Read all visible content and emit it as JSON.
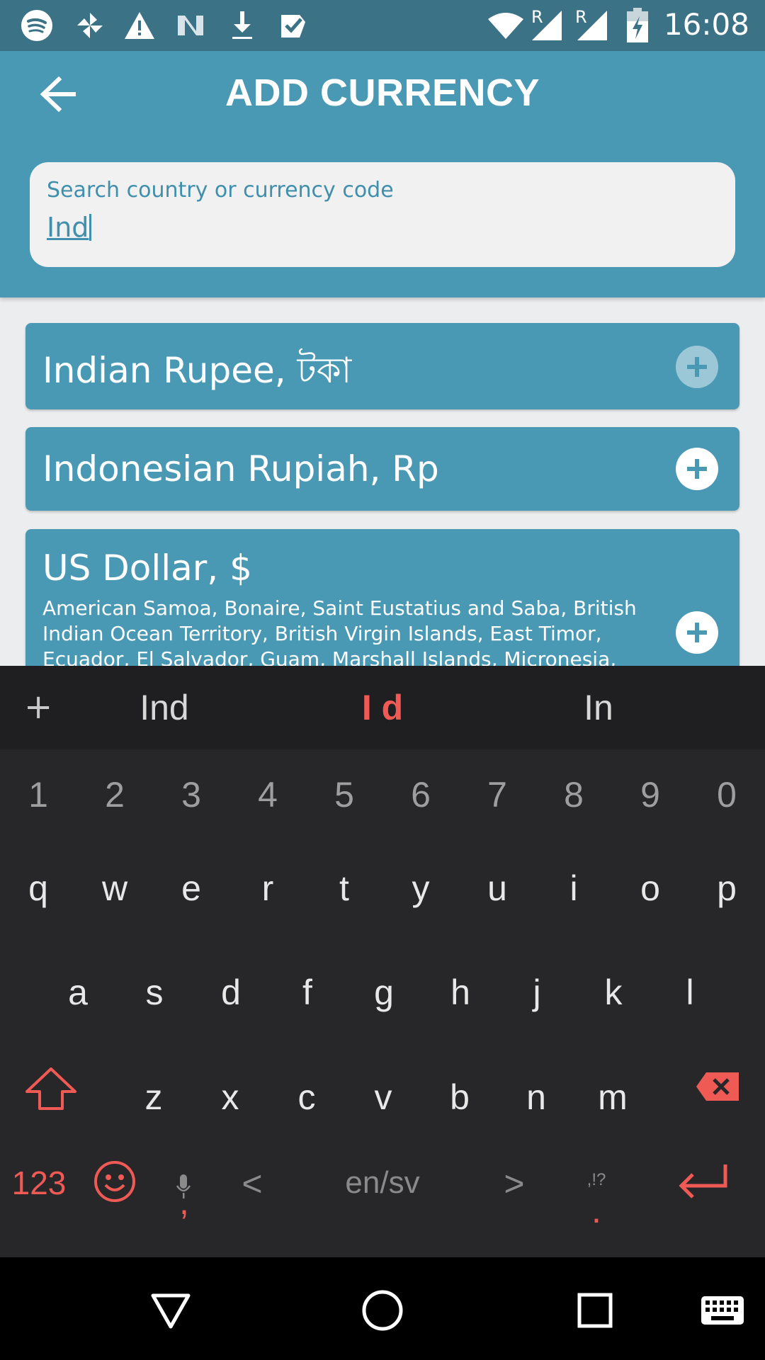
{
  "status_bar": {
    "time": "16:08",
    "left_icons": [
      "spotify-icon",
      "pinwheel-icon",
      "warning-icon",
      "n-icon",
      "download-icon",
      "check-icon"
    ],
    "right_icons": [
      "wifi-icon",
      "signal-icon",
      "signal-icon",
      "battery-charging-icon"
    ],
    "roaming_label": "R"
  },
  "app_bar": {
    "title": "ADD CURRENCY",
    "back_icon": "arrow-left-icon"
  },
  "search": {
    "label": "Search country or currency code",
    "value": "Ind"
  },
  "currencies": [
    {
      "name": "Indian Rupee, টকা",
      "countries": "",
      "added": true
    },
    {
      "name": "Indonesian Rupiah, Rp",
      "countries": "",
      "added": false
    },
    {
      "name": "US Dollar, $",
      "countries": "American Samoa, Bonaire, Saint Eustatius and Saba, British Indian Ocean Territory, British Virgin Islands, East Timor, Ecuador, El Salvador, Guam, Marshall Islands, Micronesia, Northern Mariana",
      "added": false
    }
  ],
  "keyboard": {
    "suggestions": {
      "plus": "+",
      "left": "Ind",
      "center": "I d",
      "right": "In"
    },
    "row_numbers": [
      "1",
      "2",
      "3",
      "4",
      "5",
      "6",
      "7",
      "8",
      "9",
      "0"
    ],
    "row1": [
      "q",
      "w",
      "e",
      "r",
      "t",
      "y",
      "u",
      "i",
      "o",
      "p"
    ],
    "row2": [
      "a",
      "s",
      "d",
      "f",
      "g",
      "h",
      "j",
      "k",
      "l"
    ],
    "row3": [
      "z",
      "x",
      "c",
      "v",
      "b",
      "n",
      "m"
    ],
    "bottom": {
      "mode": "123",
      "comma": ",",
      "left_arrow": "<",
      "language": "en/sv",
      "right_arrow": ">",
      "punct_hint": ",!?",
      "period": "."
    }
  },
  "colors": {
    "status_bar": "#3C7286",
    "accent": "#4A99B4",
    "keyboard_accent": "#F05A55"
  }
}
